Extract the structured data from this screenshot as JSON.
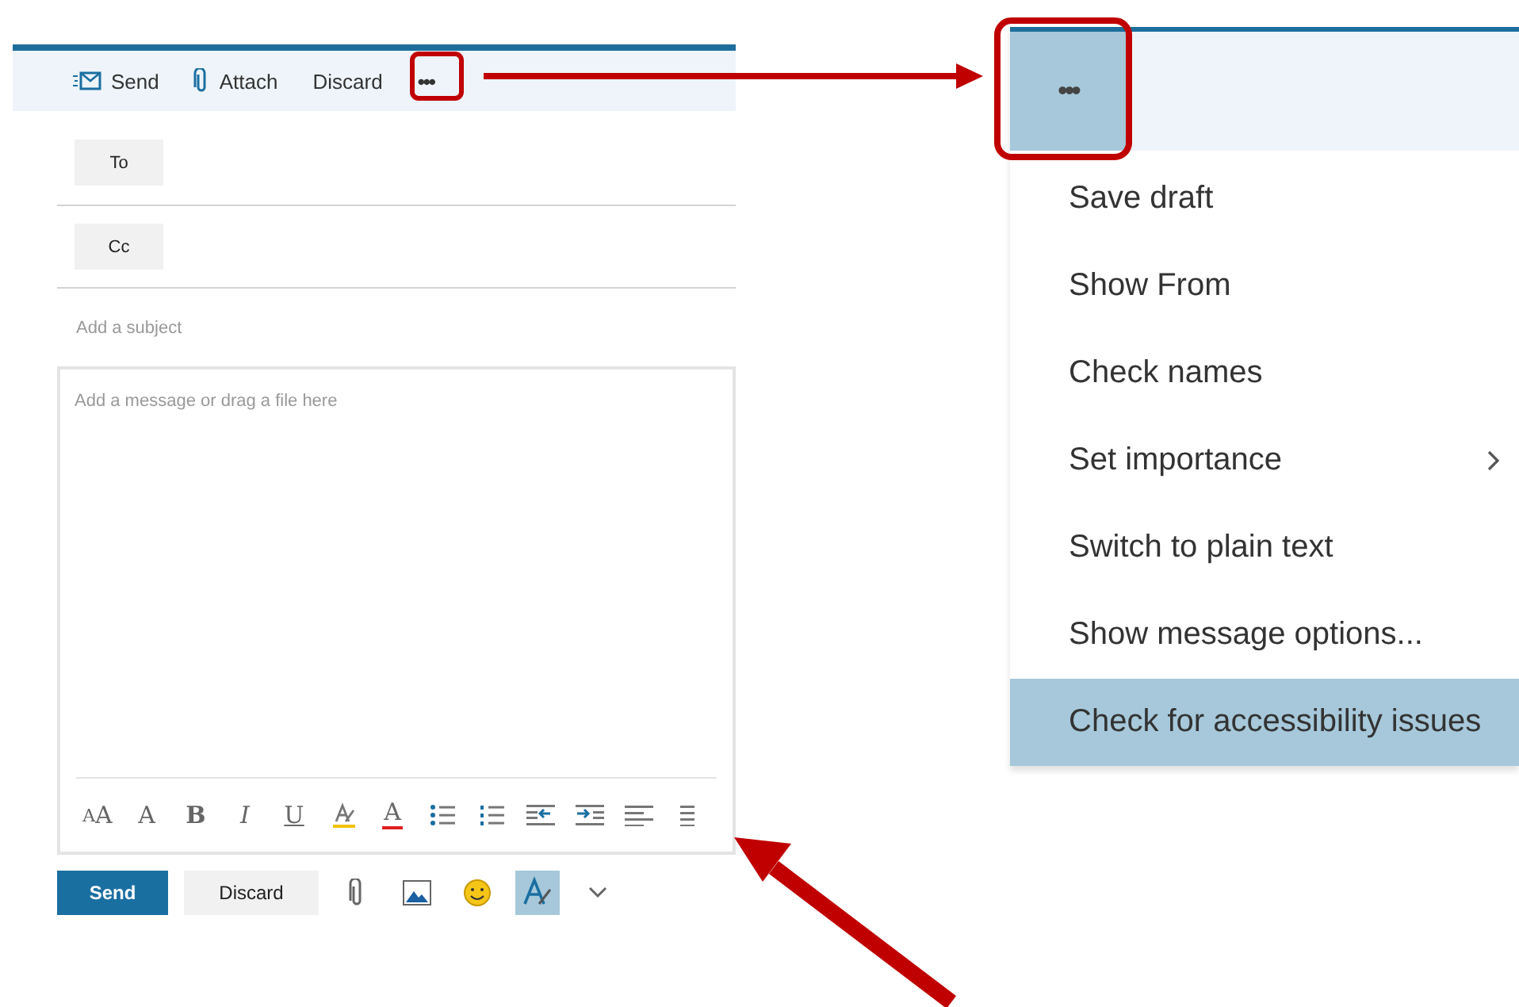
{
  "compose": {
    "toolbar": [
      {
        "kind": "send",
        "label": "Send"
      },
      {
        "kind": "attach",
        "label": "Attach"
      },
      {
        "kind": "plain",
        "label": "Discard"
      },
      {
        "kind": "more",
        "label": "•••"
      }
    ],
    "recipients": [
      {
        "label": "To"
      },
      {
        "label": "Cc"
      }
    ],
    "subject": {
      "placeholder": "Add a subject"
    },
    "body": {
      "placeholder": "Add a message or drag a file here"
    },
    "format_tools": [
      {
        "kind": "font-size",
        "label": "AA"
      },
      {
        "kind": "grow",
        "label": "A"
      },
      {
        "kind": "bold",
        "label": "B"
      },
      {
        "kind": "italic",
        "label": "I"
      },
      {
        "kind": "underline",
        "label": "U"
      },
      {
        "kind": "highlight"
      },
      {
        "kind": "font-color",
        "label": "A"
      },
      {
        "kind": "bullets"
      },
      {
        "kind": "numbering"
      },
      {
        "kind": "outdent"
      },
      {
        "kind": "indent"
      },
      {
        "kind": "align-left"
      },
      {
        "kind": "align-center"
      }
    ],
    "actions": [
      {
        "kind": "primary",
        "label": "Send"
      },
      {
        "kind": "secondary",
        "label": "Discard"
      },
      {
        "kind": "attach",
        "selected": false
      },
      {
        "kind": "image",
        "selected": false
      },
      {
        "kind": "emoji",
        "selected": false
      },
      {
        "kind": "format",
        "selected": true
      },
      {
        "kind": "chevron",
        "selected": false
      }
    ]
  },
  "more_menu": {
    "button": {
      "label": "•••"
    },
    "items": [
      {
        "label": "Save draft",
        "submenu": false,
        "selected": false
      },
      {
        "label": "Show From",
        "submenu": false,
        "selected": false
      },
      {
        "label": "Check names",
        "submenu": false,
        "selected": false
      },
      {
        "label": "Set importance",
        "submenu": true,
        "selected": false
      },
      {
        "label": "Switch to plain text",
        "submenu": false,
        "selected": false
      },
      {
        "label": "Show message options...",
        "submenu": false,
        "selected": false
      },
      {
        "label": "Check for accessibility issues",
        "submenu": false,
        "selected": true
      }
    ]
  }
}
